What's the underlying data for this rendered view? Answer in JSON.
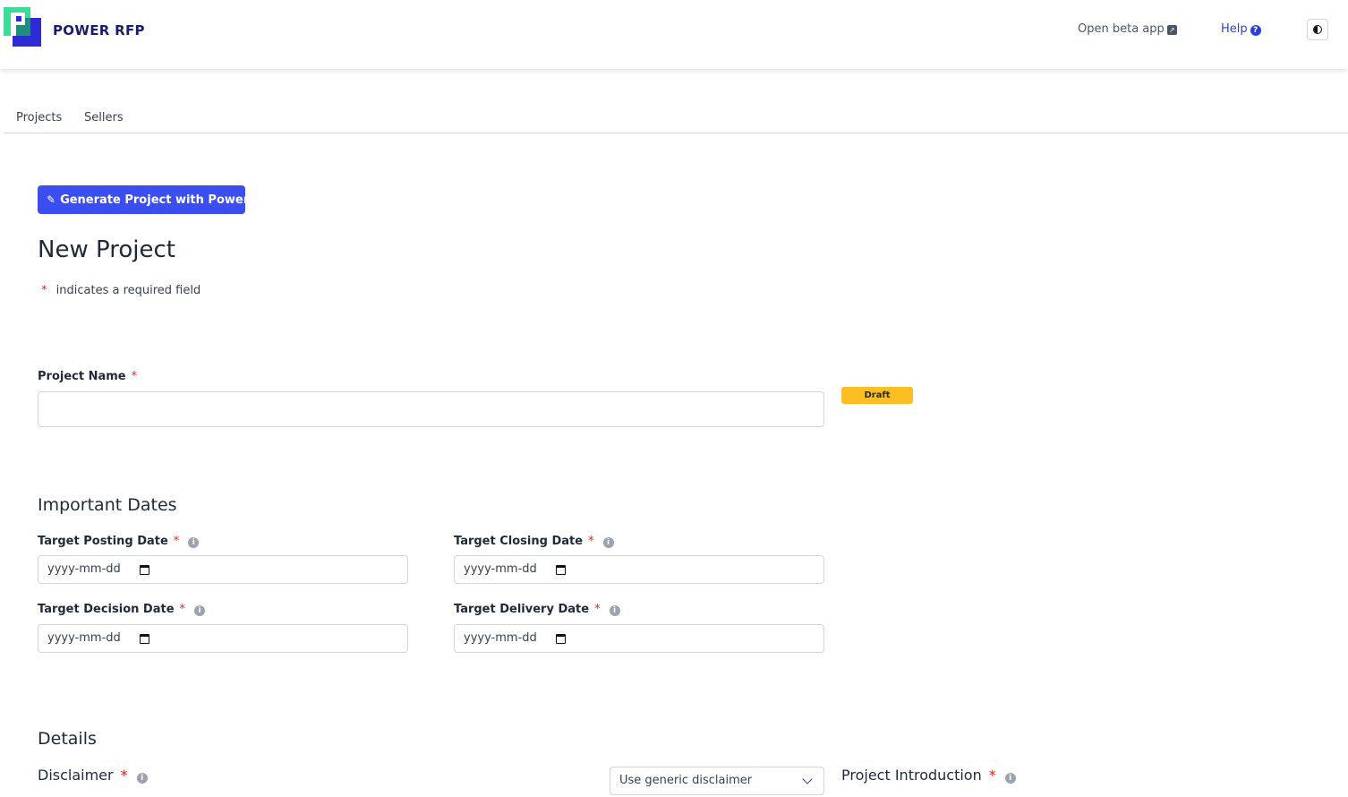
{
  "header": {
    "brand": "POWER RFP",
    "beta_link": "Open beta app",
    "help_link": "Help",
    "logo_colors": {
      "green": "#3ddc97",
      "blue": "#2d2ad6"
    }
  },
  "nav": {
    "items": [
      "Projects",
      "Sellers"
    ]
  },
  "generate_button": "Generate Project with Power AI",
  "page_title": "New Project",
  "required_note": "indicates a required field",
  "required_mark": "*",
  "project_name": {
    "label": "Project Name",
    "value": "",
    "status_badge": "Draft"
  },
  "important_dates": {
    "title": "Important Dates",
    "fields": [
      {
        "label": "Target Posting Date",
        "placeholder": "yyyy-mm-dd"
      },
      {
        "label": "Target Closing Date",
        "placeholder": "yyyy-mm-dd"
      },
      {
        "label": "Target Decision Date",
        "placeholder": "yyyy-mm-dd"
      },
      {
        "label": "Target Delivery Date",
        "placeholder": "yyyy-mm-dd"
      }
    ]
  },
  "details": {
    "title": "Details",
    "disclaimer_label": "Disclaimer",
    "disclaimer_select": "Use generic disclaimer",
    "introduction_label": "Project Introduction"
  },
  "colors": {
    "accent": "#3b4ff0",
    "draft": "#fbbf24",
    "required": "#dc2626",
    "link": "#2b3fd8"
  }
}
